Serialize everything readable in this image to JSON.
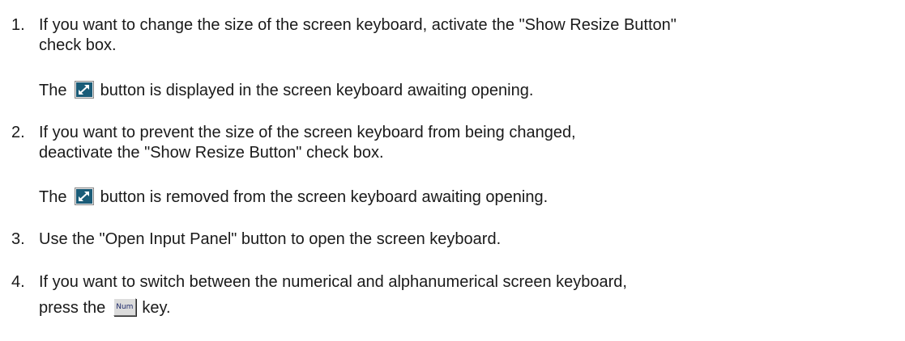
{
  "steps": [
    {
      "number": "1.",
      "lines": [
        "If you want to change the size of the screen keyboard, activate the \"Show Resize Button\"",
        "check box."
      ],
      "result": {
        "before_icon": "The",
        "icon": "resize-icon",
        "after_icon": "button is displayed in the screen keyboard awaiting opening."
      }
    },
    {
      "number": "2.",
      "lines": [
        "If you want to prevent the size of the screen keyboard from being changed,",
        "deactivate the \"Show Resize Button\" check box."
      ],
      "result": {
        "before_icon": "The",
        "icon": "resize-icon",
        "after_icon": "button is removed from the screen keyboard awaiting opening."
      }
    },
    {
      "number": "3.",
      "lines": [
        "Use the \"Open Input Panel\" button to open the screen keyboard."
      ]
    },
    {
      "number": "4.",
      "lines": [
        "If you want to switch between the numerical and alphanumerical screen keyboard,",
        "press the"
      ],
      "key_label": "Num",
      "after_key": "key."
    }
  ],
  "colors": {
    "text": "#1a1a1a",
    "resize_icon_background": "#1a5c78",
    "resize_icon_arrow": "#ffffff"
  }
}
